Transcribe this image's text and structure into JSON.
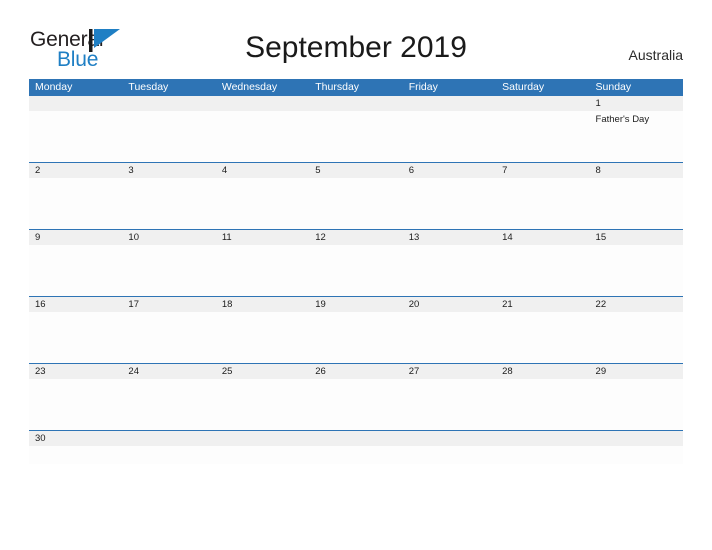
{
  "brand": {
    "name_part1": "General",
    "name_part2": "Blue",
    "flag_icon": "blue-flag-triangle-icon",
    "color_dark": "#231f20",
    "color_blue": "#1f7fc4"
  },
  "header": {
    "title": "September 2019",
    "country": "Australia"
  },
  "theme": {
    "header_blue": "#2e74b5",
    "row_divider_blue": "#2e74b5",
    "daynum_band_gray": "#f0f0f0",
    "cell_background": "#fdfdfd",
    "text_color": "#1c1c1c"
  },
  "calendar": {
    "weekdays": [
      "Monday",
      "Tuesday",
      "Wednesday",
      "Thursday",
      "Friday",
      "Saturday",
      "Sunday"
    ],
    "weeks": [
      {
        "days": [
          {
            "num": "",
            "event": ""
          },
          {
            "num": "",
            "event": ""
          },
          {
            "num": "",
            "event": ""
          },
          {
            "num": "",
            "event": ""
          },
          {
            "num": "",
            "event": ""
          },
          {
            "num": "",
            "event": ""
          },
          {
            "num": "1",
            "event": "Father's Day"
          }
        ]
      },
      {
        "days": [
          {
            "num": "2",
            "event": ""
          },
          {
            "num": "3",
            "event": ""
          },
          {
            "num": "4",
            "event": ""
          },
          {
            "num": "5",
            "event": ""
          },
          {
            "num": "6",
            "event": ""
          },
          {
            "num": "7",
            "event": ""
          },
          {
            "num": "8",
            "event": ""
          }
        ]
      },
      {
        "days": [
          {
            "num": "9",
            "event": ""
          },
          {
            "num": "10",
            "event": ""
          },
          {
            "num": "11",
            "event": ""
          },
          {
            "num": "12",
            "event": ""
          },
          {
            "num": "13",
            "event": ""
          },
          {
            "num": "14",
            "event": ""
          },
          {
            "num": "15",
            "event": ""
          }
        ]
      },
      {
        "days": [
          {
            "num": "16",
            "event": ""
          },
          {
            "num": "17",
            "event": ""
          },
          {
            "num": "18",
            "event": ""
          },
          {
            "num": "19",
            "event": ""
          },
          {
            "num": "20",
            "event": ""
          },
          {
            "num": "21",
            "event": ""
          },
          {
            "num": "22",
            "event": ""
          }
        ]
      },
      {
        "days": [
          {
            "num": "23",
            "event": ""
          },
          {
            "num": "24",
            "event": ""
          },
          {
            "num": "25",
            "event": ""
          },
          {
            "num": "26",
            "event": ""
          },
          {
            "num": "27",
            "event": ""
          },
          {
            "num": "28",
            "event": ""
          },
          {
            "num": "29",
            "event": ""
          }
        ]
      },
      {
        "days": [
          {
            "num": "30",
            "event": ""
          },
          {
            "num": "",
            "event": ""
          },
          {
            "num": "",
            "event": ""
          },
          {
            "num": "",
            "event": ""
          },
          {
            "num": "",
            "event": ""
          },
          {
            "num": "",
            "event": ""
          },
          {
            "num": "",
            "event": ""
          }
        ]
      }
    ]
  }
}
